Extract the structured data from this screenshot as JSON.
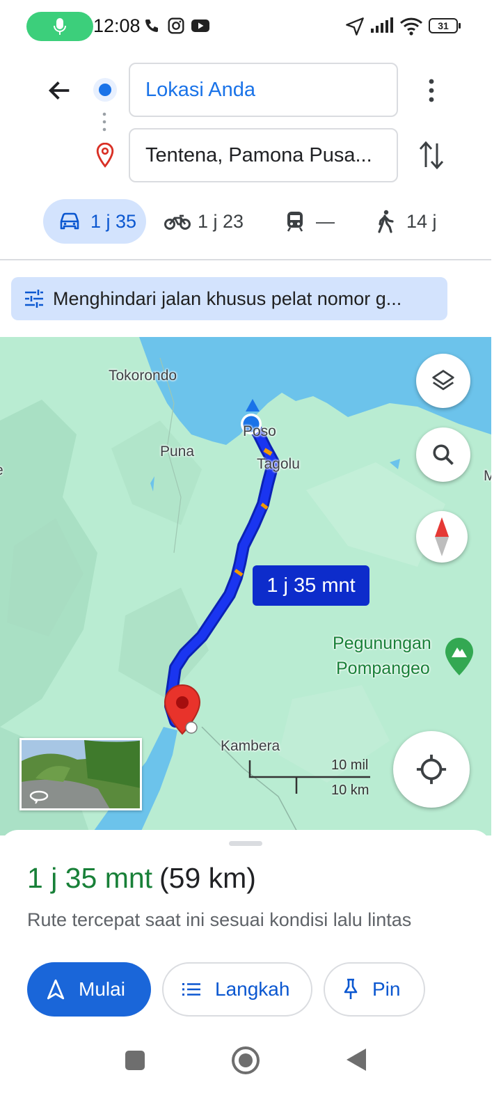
{
  "status_bar": {
    "time": "12:08",
    "battery": "31",
    "icons": [
      "mic-icon",
      "phone-icon",
      "instagram-icon",
      "youtube-icon",
      "location-arrow-icon",
      "signal-icon",
      "wifi-icon",
      "battery-icon"
    ]
  },
  "search": {
    "origin": "Lokasi Anda",
    "destination": "Tentena, Pamona Pusa..."
  },
  "modes": {
    "car": "1 j 35",
    "motorcycle": "1 j 23",
    "transit": "—",
    "walk": "14 j"
  },
  "chip": {
    "label": "Menghindari jalan khusus pelat nomor g..."
  },
  "map": {
    "labels": {
      "tokorondo": "Tokorondo",
      "poso": "Poso",
      "puna": "Puna",
      "tagolu": "Tagolu",
      "mountains_1": "Pegunungan",
      "mountains_2": "Pompangeo",
      "kambera": "Kambera",
      "edge_left": "e",
      "edge_right": "M"
    },
    "eta_bubble": "1 j 35 mnt",
    "scale": {
      "miles": "10 mil",
      "km": "10 km"
    }
  },
  "sheet": {
    "duration": "1 j 35 mnt",
    "distance": "(59 km)",
    "description": "Rute tercepat saat ini sesuai kondisi lalu lintas",
    "start_label": "Mulai",
    "steps_label": "Langkah",
    "pin_label": "Pin"
  },
  "colors": {
    "accent": "#1a73e8",
    "route": "#1a35f0",
    "eta_green": "#188038",
    "water": "#6cc3eb",
    "land": "#b9ecd2"
  }
}
